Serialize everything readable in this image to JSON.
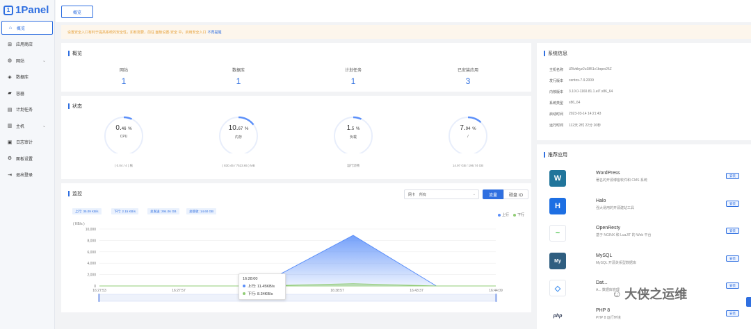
{
  "brand": {
    "logo_text": "1Panel"
  },
  "sidebar": {
    "items": [
      {
        "label": "概览",
        "icon": "home-icon"
      },
      {
        "label": "应用商店",
        "icon": "grid-icon"
      },
      {
        "label": "网站",
        "icon": "globe-icon"
      },
      {
        "label": "数据库",
        "icon": "database-icon"
      },
      {
        "label": "容器",
        "icon": "container-icon"
      },
      {
        "label": "计划任务",
        "icon": "calendar-icon"
      },
      {
        "label": "主机",
        "icon": "server-icon"
      },
      {
        "label": "日志审计",
        "icon": "log-icon"
      },
      {
        "label": "面板设置",
        "icon": "gear-icon"
      },
      {
        "label": "退出登录",
        "icon": "logout-icon"
      }
    ]
  },
  "topbar": {
    "tab_label": "概览"
  },
  "alert": {
    "text": "设置安全入口有利于提高系统的安全性，如有需要，前往 面板设置-安全 中，启用安全入口",
    "link": "不再提醒"
  },
  "overview": {
    "title": "概览",
    "stats": [
      {
        "label": "网站",
        "value": "1"
      },
      {
        "label": "数据库",
        "value": "1"
      },
      {
        "label": "计划任务",
        "value": "1"
      },
      {
        "label": "已安装应用",
        "value": "3"
      }
    ]
  },
  "status": {
    "title": "状态",
    "gauges": [
      {
        "value": "0.",
        "decimal": "46",
        "unit": "%",
        "label": "CPU",
        "sub": "( 0.04 / 4 ) 核",
        "percent": 0.46
      },
      {
        "value": "10.",
        "decimal": "67",
        "unit": "%",
        "label": "内存",
        "sub": "( 830.45 / 7523.65 ) MB",
        "percent": 10.67
      },
      {
        "value": "1",
        "decimal": ".5",
        "unit": "%",
        "label": "负载",
        "sub": "运行流畅",
        "percent": 1.5
      },
      {
        "value": "7.",
        "decimal": "94",
        "unit": "%",
        "label": "/",
        "sub": "14.97 GB / 196.74 GB",
        "percent": 7.94
      }
    ]
  },
  "monitor": {
    "title": "监控",
    "select_label": "网卡",
    "select_value": "所有",
    "btn_traffic": "流量",
    "btn_io": "磁盘 IO",
    "tags": [
      "上行: 35.09 KB/s",
      "下行: 2.15 KB/s",
      "总发送: 294.06 GB",
      "总接收: 14.60 GB"
    ],
    "legend_up": "上行",
    "legend_down": "下行",
    "tooltip": {
      "time": "16:28:00",
      "up_label": "上行: 11.45KB/s",
      "down_label": "下行: 8.34KB/s"
    }
  },
  "chart_data": {
    "type": "area",
    "ylabel": "( KB/s )",
    "ylim": [
      0,
      10000
    ],
    "yticks": [
      "10,000",
      "8,000",
      "6,000",
      "4,000",
      "2,000",
      "0"
    ],
    "xticks": [
      "16:27:53",
      "16:27:57",
      "16:28:00",
      "16:38:57",
      "16:43:37",
      "16:44:09"
    ],
    "series": [
      {
        "name": "上行",
        "color": "#5b8ff9",
        "x": [
          0,
          0.26,
          0.4,
          0.64,
          0.85,
          1.0
        ],
        "values": [
          0,
          0,
          0,
          8900,
          0,
          0
        ]
      },
      {
        "name": "下行",
        "color": "#91cc75",
        "x": [
          0,
          0.26,
          0.4,
          0.64,
          0.85,
          1.0
        ],
        "values": [
          0,
          0,
          0,
          400,
          0,
          0
        ]
      }
    ]
  },
  "sysinfo": {
    "title": "系统信息",
    "rows": [
      {
        "key": "主机名称",
        "value": "iZ8vbbyz2u3851c1bqeo25Z"
      },
      {
        "key": "发行版本",
        "value": "centos-7.9.2009"
      },
      {
        "key": "内核版本",
        "value": "3.10.0-1160.81.1.el7.x86_64"
      },
      {
        "key": "系统类型",
        "value": "x86_64"
      },
      {
        "key": "启动时间",
        "value": "2023-03-14 14:21:43"
      },
      {
        "key": "运行时间",
        "value": "112天 2时 22分 26秒"
      }
    ]
  },
  "apps": {
    "title": "推荐应用",
    "install_label": "安装",
    "items": [
      {
        "name": "WordPress",
        "desc": "著名的开源博客软件和 CMS 系统",
        "icon": "wordpress-icon",
        "glyph": "W",
        "color": "#21759b"
      },
      {
        "name": "Halo",
        "desc": "强大易用的开源建站工具",
        "icon": "halo-icon",
        "glyph": "H",
        "color": "#1d6fe3"
      },
      {
        "name": "OpenResty",
        "desc": "基于 NGINX 和 LuaJIT 的 Web 平台",
        "icon": "openresty-icon",
        "glyph": "~",
        "color": "#3fbf3f"
      },
      {
        "name": "MySQL",
        "desc": "MySQL 开源关系型数据库",
        "icon": "mysql-icon",
        "glyph": "My",
        "color": "#2f5e80"
      },
      {
        "name": "Dat...",
        "desc": "A... 数据库管理",
        "icon": "database-app-icon",
        "glyph": "◇",
        "color": "#3d8ef0"
      },
      {
        "name": "PHP 8",
        "desc": "PHP 8 运行环境",
        "icon": "php-icon",
        "glyph": "php",
        "color": "#2f3a55"
      }
    ]
  },
  "watermark": {
    "text": "大侠之运维"
  }
}
